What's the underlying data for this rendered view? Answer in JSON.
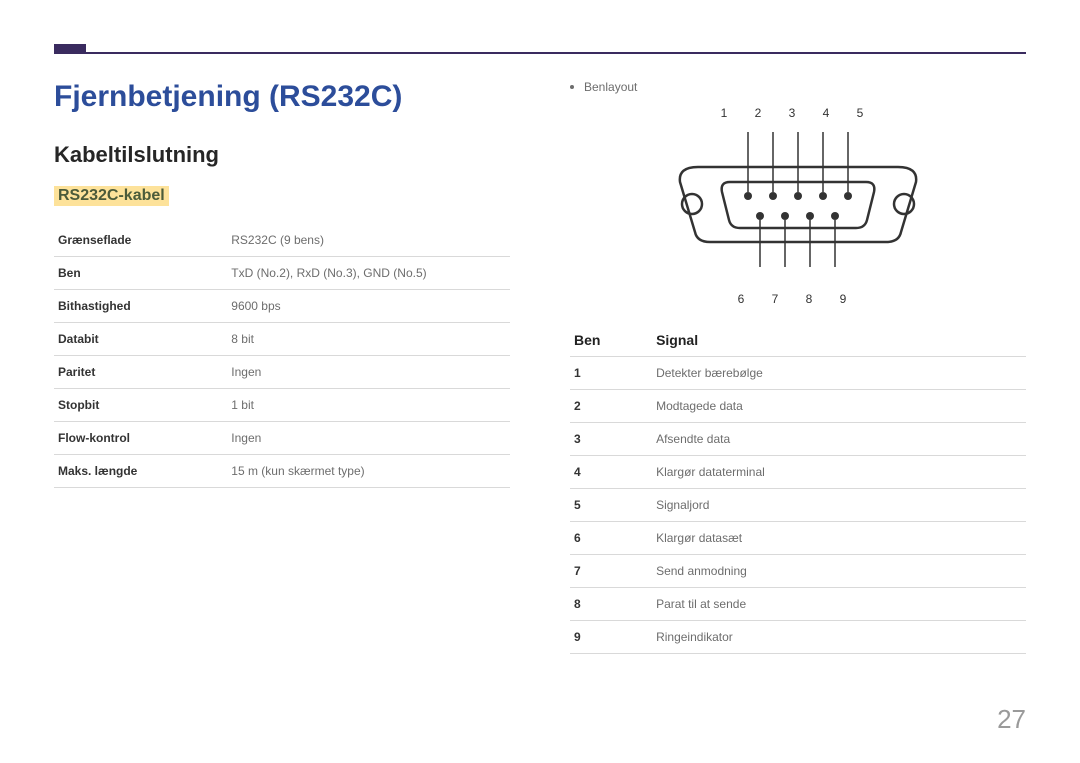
{
  "title": "Fjernbetjening (RS232C)",
  "section": "Kabeltilslutning",
  "subsection": "RS232C-kabel",
  "spec_table": [
    {
      "key": "Grænseflade",
      "val": "RS232C (9 bens)"
    },
    {
      "key": "Ben",
      "val": "TxD (No.2), RxD (No.3), GND (No.5)"
    },
    {
      "key": "Bithastighed",
      "val": "9600 bps"
    },
    {
      "key": "Databit",
      "val": "8 bit"
    },
    {
      "key": "Paritet",
      "val": "Ingen"
    },
    {
      "key": "Stopbit",
      "val": "1 bit"
    },
    {
      "key": "Flow-kontrol",
      "val": "Ingen"
    },
    {
      "key": "Maks. længde",
      "val": "15 m (kun skærmet type)"
    }
  ],
  "benlayout_label": "Benlayout",
  "pin_top": "1 2 3 4 5",
  "pin_bottom": "6 7 8 9",
  "signal_headers": {
    "pin": "Ben",
    "signal": "Signal"
  },
  "signal_table": [
    {
      "pin": "1",
      "signal": "Detekter bærebølge"
    },
    {
      "pin": "2",
      "signal": "Modtagede data"
    },
    {
      "pin": "3",
      "signal": "Afsendte data"
    },
    {
      "pin": "4",
      "signal": "Klargør dataterminal"
    },
    {
      "pin": "5",
      "signal": "Signaljord"
    },
    {
      "pin": "6",
      "signal": "Klargør datasæt"
    },
    {
      "pin": "7",
      "signal": "Send anmodning"
    },
    {
      "pin": "8",
      "signal": "Parat til at sende"
    },
    {
      "pin": "9",
      "signal": "Ringeindikator"
    }
  ],
  "page_number": "27"
}
